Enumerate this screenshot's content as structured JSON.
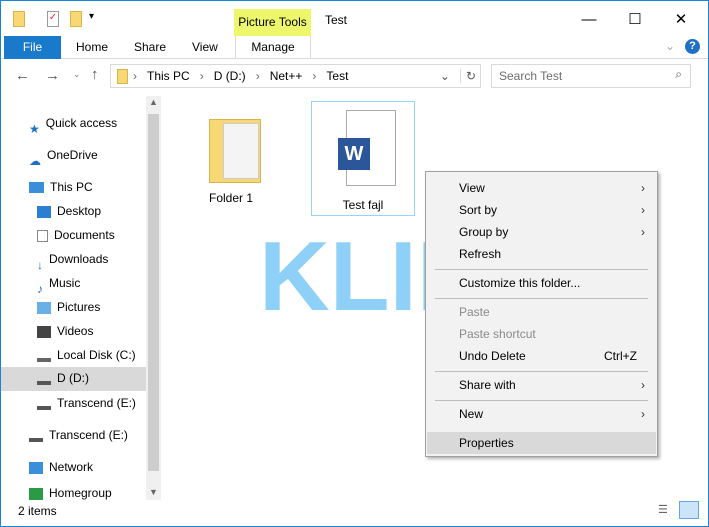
{
  "window": {
    "title": "Test",
    "context_tab": "Picture Tools"
  },
  "ribbon": {
    "tabs": [
      "File",
      "Home",
      "Share",
      "View",
      "Manage"
    ]
  },
  "address": {
    "path": [
      "This PC",
      "D (D:)",
      "Net++",
      "Test"
    ],
    "search_placeholder": "Search Test"
  },
  "nav": {
    "items": [
      "Quick access",
      "OneDrive",
      "This PC",
      "Desktop",
      "Documents",
      "Downloads",
      "Music",
      "Pictures",
      "Videos",
      "Local Disk (C:)",
      "D (D:)",
      "Transcend (E:)",
      "Transcend (E:)",
      "Network",
      "Homegroup"
    ],
    "selected": "D (D:)"
  },
  "files": [
    {
      "name": "Folder 1",
      "type": "folder"
    },
    {
      "name": "Test fajl",
      "type": "word-document"
    }
  ],
  "context_menu": {
    "items": [
      {
        "label": "View",
        "submenu": true
      },
      {
        "label": "Sort by",
        "submenu": true
      },
      {
        "label": "Group by",
        "submenu": true
      },
      {
        "label": "Refresh"
      },
      {
        "label": "Customize this folder..."
      },
      {
        "label": "Paste",
        "disabled": true
      },
      {
        "label": "Paste shortcut",
        "disabled": true
      },
      {
        "label": "Undo Delete",
        "shortcut": "Ctrl+Z"
      },
      {
        "label": "Share with",
        "submenu": true
      },
      {
        "label": "New",
        "submenu": true
      },
      {
        "label": "Properties",
        "highlighted": true
      }
    ]
  },
  "status": {
    "count": "2 items"
  },
  "watermark": "KLINIKA",
  "colors": {
    "accent": "#1979ca",
    "context_tab": "#eef76b",
    "menu_highlight": "#d9d9d9"
  }
}
